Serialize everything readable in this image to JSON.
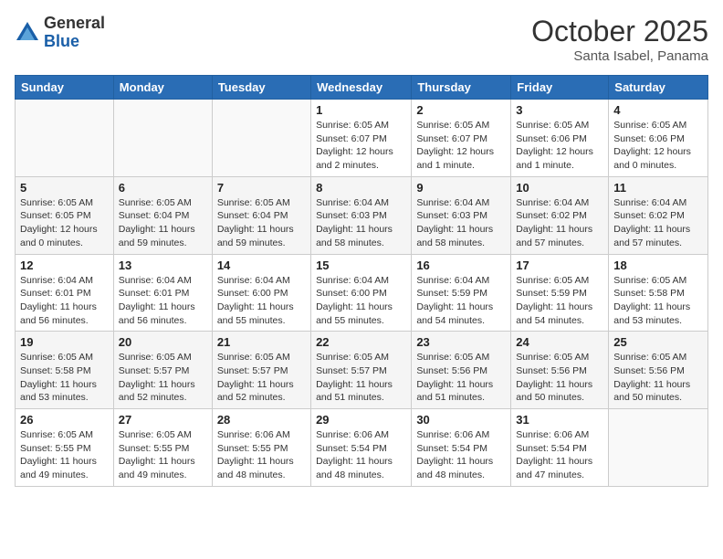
{
  "header": {
    "logo_general": "General",
    "logo_blue": "Blue",
    "month_title": "October 2025",
    "subtitle": "Santa Isabel, Panama"
  },
  "weekdays": [
    "Sunday",
    "Monday",
    "Tuesday",
    "Wednesday",
    "Thursday",
    "Friday",
    "Saturday"
  ],
  "weeks": [
    [
      {
        "day": "",
        "info": ""
      },
      {
        "day": "",
        "info": ""
      },
      {
        "day": "",
        "info": ""
      },
      {
        "day": "1",
        "info": "Sunrise: 6:05 AM\nSunset: 6:07 PM\nDaylight: 12 hours and 2 minutes."
      },
      {
        "day": "2",
        "info": "Sunrise: 6:05 AM\nSunset: 6:07 PM\nDaylight: 12 hours and 1 minute."
      },
      {
        "day": "3",
        "info": "Sunrise: 6:05 AM\nSunset: 6:06 PM\nDaylight: 12 hours and 1 minute."
      },
      {
        "day": "4",
        "info": "Sunrise: 6:05 AM\nSunset: 6:06 PM\nDaylight: 12 hours and 0 minutes."
      }
    ],
    [
      {
        "day": "5",
        "info": "Sunrise: 6:05 AM\nSunset: 6:05 PM\nDaylight: 12 hours and 0 minutes."
      },
      {
        "day": "6",
        "info": "Sunrise: 6:05 AM\nSunset: 6:04 PM\nDaylight: 11 hours and 59 minutes."
      },
      {
        "day": "7",
        "info": "Sunrise: 6:05 AM\nSunset: 6:04 PM\nDaylight: 11 hours and 59 minutes."
      },
      {
        "day": "8",
        "info": "Sunrise: 6:04 AM\nSunset: 6:03 PM\nDaylight: 11 hours and 58 minutes."
      },
      {
        "day": "9",
        "info": "Sunrise: 6:04 AM\nSunset: 6:03 PM\nDaylight: 11 hours and 58 minutes."
      },
      {
        "day": "10",
        "info": "Sunrise: 6:04 AM\nSunset: 6:02 PM\nDaylight: 11 hours and 57 minutes."
      },
      {
        "day": "11",
        "info": "Sunrise: 6:04 AM\nSunset: 6:02 PM\nDaylight: 11 hours and 57 minutes."
      }
    ],
    [
      {
        "day": "12",
        "info": "Sunrise: 6:04 AM\nSunset: 6:01 PM\nDaylight: 11 hours and 56 minutes."
      },
      {
        "day": "13",
        "info": "Sunrise: 6:04 AM\nSunset: 6:01 PM\nDaylight: 11 hours and 56 minutes."
      },
      {
        "day": "14",
        "info": "Sunrise: 6:04 AM\nSunset: 6:00 PM\nDaylight: 11 hours and 55 minutes."
      },
      {
        "day": "15",
        "info": "Sunrise: 6:04 AM\nSunset: 6:00 PM\nDaylight: 11 hours and 55 minutes."
      },
      {
        "day": "16",
        "info": "Sunrise: 6:04 AM\nSunset: 5:59 PM\nDaylight: 11 hours and 54 minutes."
      },
      {
        "day": "17",
        "info": "Sunrise: 6:05 AM\nSunset: 5:59 PM\nDaylight: 11 hours and 54 minutes."
      },
      {
        "day": "18",
        "info": "Sunrise: 6:05 AM\nSunset: 5:58 PM\nDaylight: 11 hours and 53 minutes."
      }
    ],
    [
      {
        "day": "19",
        "info": "Sunrise: 6:05 AM\nSunset: 5:58 PM\nDaylight: 11 hours and 53 minutes."
      },
      {
        "day": "20",
        "info": "Sunrise: 6:05 AM\nSunset: 5:57 PM\nDaylight: 11 hours and 52 minutes."
      },
      {
        "day": "21",
        "info": "Sunrise: 6:05 AM\nSunset: 5:57 PM\nDaylight: 11 hours and 52 minutes."
      },
      {
        "day": "22",
        "info": "Sunrise: 6:05 AM\nSunset: 5:57 PM\nDaylight: 11 hours and 51 minutes."
      },
      {
        "day": "23",
        "info": "Sunrise: 6:05 AM\nSunset: 5:56 PM\nDaylight: 11 hours and 51 minutes."
      },
      {
        "day": "24",
        "info": "Sunrise: 6:05 AM\nSunset: 5:56 PM\nDaylight: 11 hours and 50 minutes."
      },
      {
        "day": "25",
        "info": "Sunrise: 6:05 AM\nSunset: 5:56 PM\nDaylight: 11 hours and 50 minutes."
      }
    ],
    [
      {
        "day": "26",
        "info": "Sunrise: 6:05 AM\nSunset: 5:55 PM\nDaylight: 11 hours and 49 minutes."
      },
      {
        "day": "27",
        "info": "Sunrise: 6:05 AM\nSunset: 5:55 PM\nDaylight: 11 hours and 49 minutes."
      },
      {
        "day": "28",
        "info": "Sunrise: 6:06 AM\nSunset: 5:55 PM\nDaylight: 11 hours and 48 minutes."
      },
      {
        "day": "29",
        "info": "Sunrise: 6:06 AM\nSunset: 5:54 PM\nDaylight: 11 hours and 48 minutes."
      },
      {
        "day": "30",
        "info": "Sunrise: 6:06 AM\nSunset: 5:54 PM\nDaylight: 11 hours and 48 minutes."
      },
      {
        "day": "31",
        "info": "Sunrise: 6:06 AM\nSunset: 5:54 PM\nDaylight: 11 hours and 47 minutes."
      },
      {
        "day": "",
        "info": ""
      }
    ]
  ]
}
